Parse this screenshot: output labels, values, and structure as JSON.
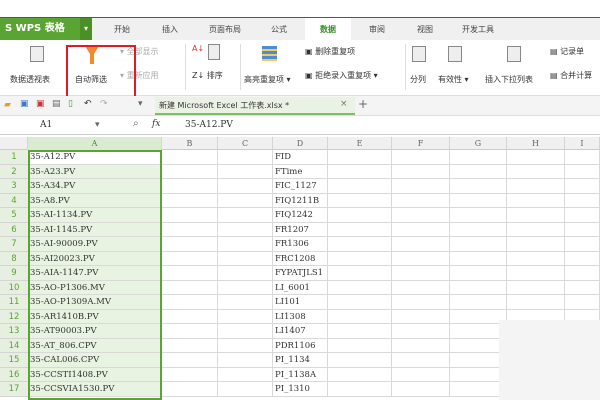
{
  "app": {
    "logo": "S WPS 表格",
    "logo_arrow": "▾"
  },
  "tabs": [
    "开始",
    "插入",
    "页面布局",
    "公式",
    "数据",
    "审阅",
    "视图",
    "开发工具"
  ],
  "active_tab": "数据",
  "ribbon": {
    "pivot": "数据透视表",
    "autofilter": "自动筛选",
    "show_all": "全部显示",
    "reapply": "重新应用",
    "sort": "排序",
    "highlight_dup": "高亮重复项 ▾",
    "delete_dup": "删除重复项",
    "reject_dup": "拒绝录入重复项 ▾",
    "split": "分列",
    "validity": "有效性 ▾",
    "insert_dropdown": "插入下拉列表",
    "record": "记录单",
    "merge_calc": "合并计算"
  },
  "qat": {
    "doc_tab": "新建 Microsoft Excel 工作表.xlsx *",
    "close": "×",
    "add": "+"
  },
  "formula_bar": {
    "cell_ref": "A1",
    "fx": "fx",
    "value": "35-A12.PV"
  },
  "columns": [
    "A",
    "B",
    "C",
    "D",
    "E",
    "F",
    "G",
    "H",
    "I"
  ],
  "rows": [
    {
      "n": "1",
      "a": "35-A12.PV",
      "d": "FID"
    },
    {
      "n": "2",
      "a": "35-A23.PV",
      "d": "FTime"
    },
    {
      "n": "3",
      "a": "35-A34.PV",
      "d": "FIC_1127"
    },
    {
      "n": "4",
      "a": "35-A8.PV",
      "d": "FIQ1211B"
    },
    {
      "n": "5",
      "a": "35-AI-1134.PV",
      "d": "FIQ1242"
    },
    {
      "n": "6",
      "a": "35-AI-1145.PV",
      "d": "FR1207"
    },
    {
      "n": "7",
      "a": "35-AI-90009.PV",
      "d": "FR1306"
    },
    {
      "n": "8",
      "a": "35-AI20023.PV",
      "d": "FRC1208"
    },
    {
      "n": "9",
      "a": "35-AIA-1147.PV",
      "d": "FYPATJLS1"
    },
    {
      "n": "10",
      "a": "35-AO-P1306.MV",
      "d": "LI_6001"
    },
    {
      "n": "11",
      "a": "35-AO-P1309A.MV",
      "d": "LI101"
    },
    {
      "n": "12",
      "a": "35-AR1410B.PV",
      "d": "LI1308"
    },
    {
      "n": "13",
      "a": "35-AT90003.PV",
      "d": "LI1407"
    },
    {
      "n": "14",
      "a": "35-AT_806.CPV",
      "d": "PDR1106"
    },
    {
      "n": "15",
      "a": "35-CAL006.CPV",
      "d": "PI_1134"
    },
    {
      "n": "16",
      "a": "35-CCSTI1408.PV",
      "d": "PI_1138A"
    },
    {
      "n": "17",
      "a": "35-CCSVIA1530.PV",
      "d": "PI_1310"
    }
  ]
}
